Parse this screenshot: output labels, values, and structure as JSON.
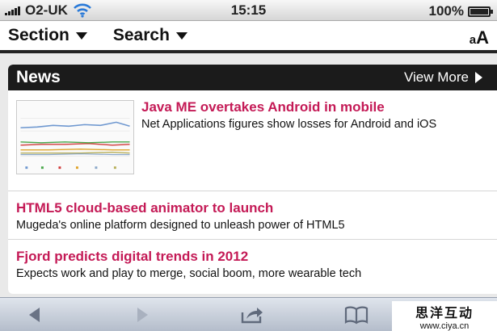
{
  "status_bar": {
    "carrier": "O2-UK",
    "time": "15:15",
    "battery_percent": "100%",
    "battery_level": 1.0
  },
  "nav": {
    "section_label": "Section",
    "search_label": "Search",
    "text_size_label": "AA"
  },
  "news": {
    "header_title": "News",
    "view_more_label": "View More",
    "articles": [
      {
        "headline": "Java ME overtakes Android in mobile",
        "summary": "Net Applications figures show losses for Android and iOS"
      },
      {
        "headline": "HTML5 cloud-based animator to launch",
        "summary": "Mugeda's online platform designed to unleash power of HTML5"
      },
      {
        "headline": "Fjord predicts digital trends in 2012",
        "summary": "Expects work and play to merge, social boom, more wearable tech"
      }
    ]
  },
  "toolbar": {
    "icons": [
      "back-icon",
      "forward-icon",
      "share-icon",
      "bookmarks-icon"
    ]
  },
  "watermark": {
    "line1": "思洋互动",
    "line2": "www.ciya.cn"
  },
  "colors": {
    "headline": "#c41a56",
    "header_bg": "#1b1b1b"
  }
}
